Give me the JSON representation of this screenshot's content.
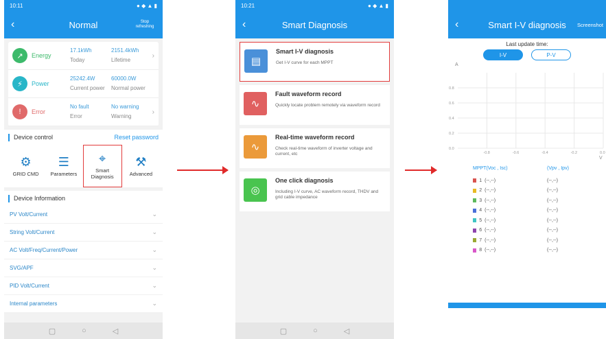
{
  "phone1": {
    "status_time": "10:11",
    "title": "Normal",
    "right_action": "Stop refreshing",
    "stats": [
      {
        "label": "Energy",
        "v1": "17.1kWh",
        "s1": "Today",
        "v2": "2151.4kWh",
        "s2": "Lifetime",
        "color": "#3dba6b",
        "icon": "chart-icon",
        "glyph": "↗"
      },
      {
        "label": "Power",
        "v1": "25242.4W",
        "s1": "Current power",
        "v2": "60000.0W",
        "s2": "Normal power",
        "color": "#29b6c8",
        "icon": "bolt-icon",
        "glyph": "⚡"
      },
      {
        "label": "Error",
        "v1": "No fault",
        "s1": "Error",
        "v2": "No warning",
        "s2": "Warning",
        "color": "#e06a6a",
        "icon": "alert-icon",
        "glyph": "!"
      }
    ],
    "device_control": "Device control",
    "reset_password": "Reset password",
    "controls": [
      {
        "label": "GRID CMD",
        "icon": "gear-icon",
        "glyph": "⚙"
      },
      {
        "label": "Parameters",
        "icon": "sliders-icon",
        "glyph": "☰"
      },
      {
        "label": "Smart Diagnosis",
        "icon": "crosshair-icon",
        "glyph": "⌖"
      },
      {
        "label": "Advanced",
        "icon": "tools-icon",
        "glyph": "⚒"
      }
    ],
    "device_info": "Device Information",
    "info_rows": [
      "PV Volt/Current",
      "String Volt/Current",
      "AC Volt/Freq/Current/Power",
      "SVG/APF",
      "PID Volt/Current",
      "Internal parameters"
    ]
  },
  "phone2": {
    "status_time": "10:21",
    "title": "Smart Diagnosis",
    "items": [
      {
        "title": "Smart I-V diagnosis",
        "desc": "Get I-V curve for each MPPT",
        "color": "#4a90d9",
        "icon": "iv-curve-icon",
        "glyph": "▤"
      },
      {
        "title": "Fault waveform record",
        "desc": "Quickly locate problem remotely via waveform record",
        "color": "#e06060",
        "icon": "fault-wave-icon",
        "glyph": "∿"
      },
      {
        "title": "Real-time waveform record",
        "desc": "Check real-time waveform of inverter voltage and current, etc",
        "color": "#eb9a3a",
        "icon": "realtime-wave-icon",
        "glyph": "∿"
      },
      {
        "title": "One click diagnosis",
        "desc": "Including I-V curve, AC waveform record, THDV and grid cable impedance",
        "color": "#49c44f",
        "icon": "one-click-icon",
        "glyph": "◎"
      }
    ]
  },
  "phone3": {
    "title": "Smart I-V diagnosis",
    "right_action": "Screenshot",
    "update_label": "Last update time:",
    "toggle": [
      "I-V",
      "P-V"
    ],
    "chart_data": {
      "type": "line",
      "xlabel": "V",
      "ylabel": "A",
      "x_ticks": [
        "-0.8",
        "-0.6",
        "-0.4",
        "-0.2",
        "0.0"
      ],
      "y_ticks": [
        "0.0",
        "0.2",
        "0.4",
        "0.6",
        "0.8"
      ],
      "xlim": [
        -1.0,
        0.0
      ],
      "ylim": [
        0.0,
        1.0
      ],
      "grid": true,
      "series": []
    },
    "legend_header": [
      "MPPT(Voc , Isc)",
      "(Vpv , Ipv)"
    ],
    "legend": [
      {
        "n": "1",
        "a": "(--,--)",
        "b": "(--,--)",
        "color": "#d9534f"
      },
      {
        "n": "2",
        "a": "(--,--)",
        "b": "(--,--)",
        "color": "#e8b923"
      },
      {
        "n": "3",
        "a": "(--,--)",
        "b": "(--,--)",
        "color": "#5cb85c"
      },
      {
        "n": "4",
        "a": "(--,--)",
        "b": "(--,--)",
        "color": "#4a6fd9"
      },
      {
        "n": "5",
        "a": "(--,--)",
        "b": "(--,--)",
        "color": "#3fc4c4"
      },
      {
        "n": "6",
        "a": "(--,--)",
        "b": "(--,--)",
        "color": "#8e44ad"
      },
      {
        "n": "7",
        "a": "(--,--)",
        "b": "(--,--)",
        "color": "#9aa832"
      },
      {
        "n": "8",
        "a": "(--,--)",
        "b": "(--,--)",
        "color": "#d957c9"
      }
    ]
  }
}
